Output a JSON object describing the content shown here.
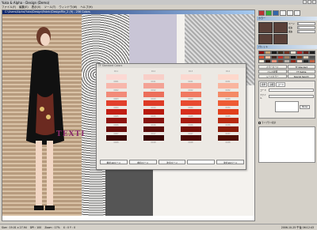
{
  "window": {
    "title": "Yuka & Alpha - Design (Demo)"
  },
  "menu": [
    "ファイル(F)",
    "編集(E)",
    "表示(V)",
    "ツール(T)",
    "ウィンドウ(W)",
    "ヘルプ(H)"
  ],
  "document": {
    "title": "C:\\Users\\Alpha\\Yuka\\Design\\Fabric\\DesignFile_2 (9) - 256 Colors",
    "overlay_text": "TEXTI"
  },
  "color_dialog": {
    "title": "TF Standard Colors",
    "groups": [
      {
        "header": "D11",
        "swatches": [
          {
            "code": "0001",
            "color": "#fbd9d4"
          },
          {
            "code": "0002",
            "color": "#f7b7ac"
          },
          {
            "code": "0003",
            "color": "#f28a78"
          },
          {
            "code": "0004",
            "color": "#e2402c"
          },
          {
            "code": "0005",
            "color": "#c21e14"
          },
          {
            "code": "0006",
            "color": "#8e1410"
          },
          {
            "code": "0007",
            "color": "#6a0e0c"
          },
          {
            "code": "0008",
            "color": "#3c0806"
          }
        ]
      },
      {
        "header": "D12",
        "swatches": [
          {
            "code": "0011",
            "color": "#f8cfc8"
          },
          {
            "code": "0012",
            "color": "#f3a295"
          },
          {
            "code": "0013",
            "color": "#ec6e5a"
          },
          {
            "code": "0014",
            "color": "#de3b26"
          },
          {
            "code": "0015",
            "color": "#b81a0e"
          },
          {
            "code": "0016",
            "color": "#861410"
          },
          {
            "code": "0017",
            "color": "#5c0d0b"
          },
          {
            "code": "0018",
            "color": "#380605"
          }
        ]
      },
      {
        "header": "D13",
        "swatches": [
          {
            "code": "0021",
            "color": "#fbd8d0"
          },
          {
            "code": "0022",
            "color": "#f6a898"
          },
          {
            "code": "0023",
            "color": "#f07860"
          },
          {
            "code": "0024",
            "color": "#e84a30"
          },
          {
            "code": "0025",
            "color": "#d82e1c"
          },
          {
            "code": "0026",
            "color": "#a61c10"
          },
          {
            "code": "0027",
            "color": "#741008"
          },
          {
            "code": "0028",
            "color": "#4c0a05"
          }
        ]
      },
      {
        "header": "D14",
        "swatches": [
          {
            "code": "0031",
            "color": "#fdd8cc"
          },
          {
            "code": "0032",
            "color": "#f9b59f"
          },
          {
            "code": "0033",
            "color": "#f48a66"
          },
          {
            "code": "0034",
            "color": "#ee5c34"
          },
          {
            "code": "0035",
            "color": "#e2401c"
          },
          {
            "code": "0036",
            "color": "#b82a10"
          },
          {
            "code": "0037",
            "color": "#8a1c0a"
          },
          {
            "code": "0038",
            "color": "#501006"
          }
        ]
      }
    ],
    "buttons": [
      "前の10ページ",
      "前のページ",
      "次のページ",
      "次の10ページ"
    ],
    "page_field": ""
  },
  "right_panel": {
    "tab1": "カラー",
    "props": [
      {
        "k": "ページ",
        "v": "1"
      },
      {
        "k": "縦糸",
        "v": "3"
      },
      {
        "k": "横糸",
        "v": "4"
      }
    ],
    "tab2": "パレット",
    "palette": [
      "#8b0a0a",
      "#c8a070",
      "#1a1a1a",
      "#3a2a1a",
      "#703020",
      "#e8e0d0",
      "#b82020",
      "#602018",
      "#202020",
      "#e05030",
      "#f0c0a0",
      "#402820",
      "#c03028",
      "#a08060",
      "#101010",
      "#803818",
      "#d8c8b0",
      "#505050",
      "#f8e8d8",
      "#301810",
      "#e89078",
      "#704030",
      "#b8b0a8",
      "#902818",
      "#f0d8c8",
      "#282828",
      "#c06040"
    ],
    "buttons": [
      "カラーカード",
      "TF Standard",
      "ペンの状態",
      "TF Textile",
      "シードカラー",
      "Special Search"
    ],
    "search_tabs": [
      "標準",
      "詳細",
      "コード"
    ],
    "search_fields": [
      {
        "k": "コード",
        "v": ""
      },
      {
        "k": "ファイル",
        "v": ""
      }
    ],
    "none_button": "None",
    "checkbox_label": "ライブラリ表示"
  },
  "status": {
    "size": "Size : 19.01 x 27.94",
    "dpi": "DPI : 100",
    "zoom": "Zoom : 17%",
    "pos": "X : 0  Y : 0",
    "clock": "2006-10-25 午後 06:12:43"
  }
}
